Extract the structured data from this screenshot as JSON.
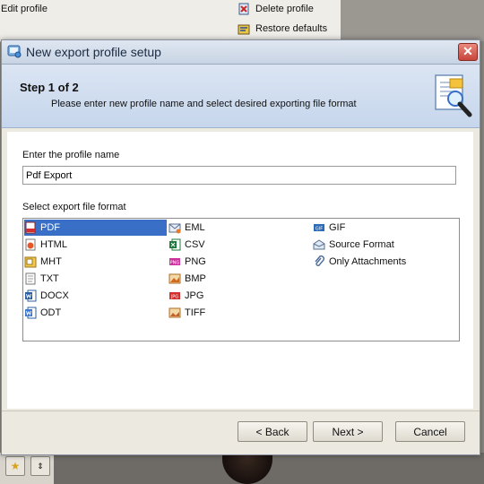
{
  "background": {
    "edit_profile": "Edit profile",
    "delete_profile": "Delete profile",
    "restore_defaults": "Restore defaults"
  },
  "dialog": {
    "title": "New export profile setup",
    "close_glyph": "✕",
    "step_title": "Step 1 of 2",
    "step_description": "Please enter new profile name and select desired exporting file format",
    "name_label": "Enter the profile name",
    "name_value": "Pdf Export",
    "format_label": "Select export file format",
    "formats": [
      {
        "label": "PDF",
        "icon": "pdf-icon",
        "selected": true
      },
      {
        "label": "HTML",
        "icon": "html-icon"
      },
      {
        "label": "MHT",
        "icon": "mht-icon"
      },
      {
        "label": "TXT",
        "icon": "txt-icon"
      },
      {
        "label": "DOCX",
        "icon": "docx-icon"
      },
      {
        "label": "ODT",
        "icon": "odt-icon"
      },
      {
        "label": "EML",
        "icon": "eml-icon"
      },
      {
        "label": "CSV",
        "icon": "csv-icon"
      },
      {
        "label": "PNG",
        "icon": "png-icon"
      },
      {
        "label": "BMP",
        "icon": "bmp-icon"
      },
      {
        "label": "JPG",
        "icon": "jpg-icon"
      },
      {
        "label": "TIFF",
        "icon": "tiff-icon"
      },
      {
        "label": "GIF",
        "icon": "gif-icon"
      },
      {
        "label": "Source Format",
        "icon": "source-format-icon"
      },
      {
        "label": "Only Attachments",
        "icon": "attachment-icon"
      }
    ],
    "buttons": {
      "back": "< Back",
      "next": "Next >",
      "cancel": "Cancel"
    }
  },
  "colors": {
    "selection": "#3a6fc8",
    "header_gradient_top": "#dbe5f3",
    "close_button": "#c7443a"
  }
}
